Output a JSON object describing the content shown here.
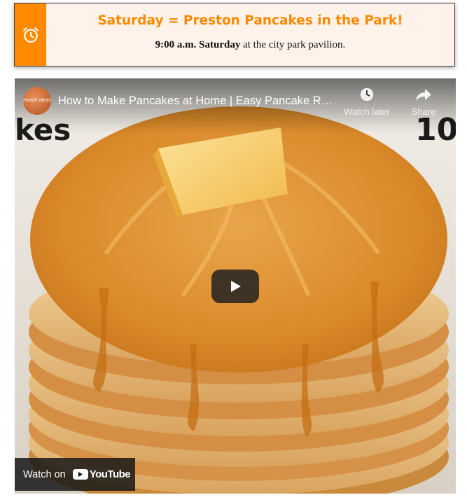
{
  "announcement": {
    "icon": "alarm-clock-icon",
    "accent_color": "#ff8a00",
    "title": "Saturday = Preston Pancakes in the Park!",
    "time_bold": "9:00 a.m. Saturday",
    "location_text": " at the city park pavilion."
  },
  "video": {
    "channel_avatar_text": "Hoorie Ideas",
    "title": "How to Make Pancakes at Home | Easy Pancake Recipe",
    "watch_later_label": "Watch later",
    "share_label": "Share",
    "thumb_side_text_left": "kes",
    "thumb_side_text_right": "10",
    "watch_on_label": "Watch on",
    "youtube_label": "YouTube",
    "icons": {
      "watch_later": "clock-icon",
      "share": "share-arrow-icon",
      "play": "play-icon",
      "brand": "youtube-logo-icon"
    }
  }
}
